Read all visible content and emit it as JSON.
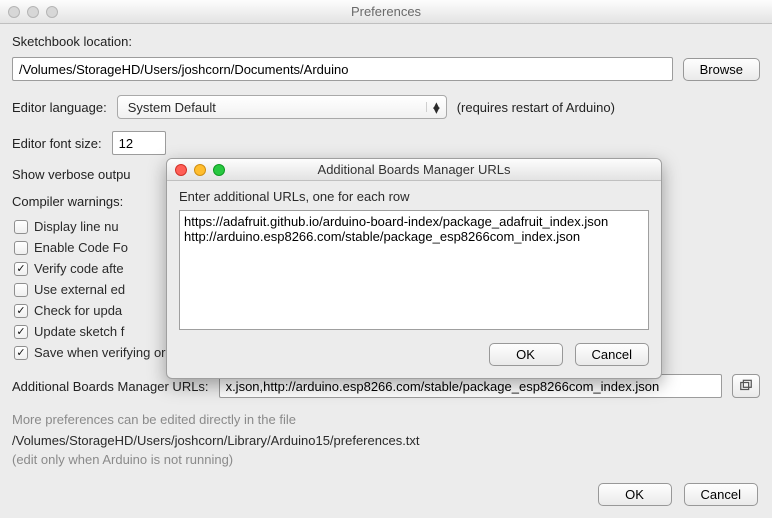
{
  "window": {
    "title": "Preferences"
  },
  "sketchbook": {
    "label": "Sketchbook location:",
    "path": "/Volumes/StorageHD/Users/joshcorn/Documents/Arduino",
    "browse_label": "Browse"
  },
  "editor_language": {
    "label": "Editor language:",
    "value": "System Default",
    "note": "(requires restart of Arduino)"
  },
  "font_size": {
    "label": "Editor font size:",
    "value": "12"
  },
  "verbose": {
    "label": "Show verbose outpu"
  },
  "compiler_warnings": {
    "label": "Compiler warnings:"
  },
  "checkboxes": {
    "line_numbers": {
      "label": "Display line nu",
      "checked": false
    },
    "code_folding": {
      "label": "Enable Code Fo",
      "checked": false
    },
    "verify_code": {
      "label": "Verify code afte",
      "checked": true
    },
    "external_ed": {
      "label": "Use external ed",
      "checked": false
    },
    "check_upd": {
      "label": "Check for upda",
      "checked": true
    },
    "update_sk": {
      "label": "Update sketch f",
      "checked": true
    },
    "save_verify": {
      "label": "Save when verifying or uploading",
      "checked": true
    }
  },
  "additional_urls": {
    "label": "Additional Boards Manager URLs:",
    "value": "x.json,http://arduino.esp8266.com/stable/package_esp8266com_index.json"
  },
  "pref_file": {
    "note": "More preferences can be edited directly in the file",
    "path": "/Volumes/StorageHD/Users/joshcorn/Library/Arduino15/preferences.txt",
    "note2": "(edit only when Arduino is not running)"
  },
  "buttons": {
    "ok": "OK",
    "cancel": "Cancel"
  },
  "modal": {
    "title": "Additional Boards Manager URLs",
    "instruction": "Enter additional URLs, one for each row",
    "text": "https://adafruit.github.io/arduino-board-index/package_adafruit_index.json\nhttp://arduino.esp8266.com/stable/package_esp8266com_index.json",
    "ok": "OK",
    "cancel": "Cancel"
  }
}
